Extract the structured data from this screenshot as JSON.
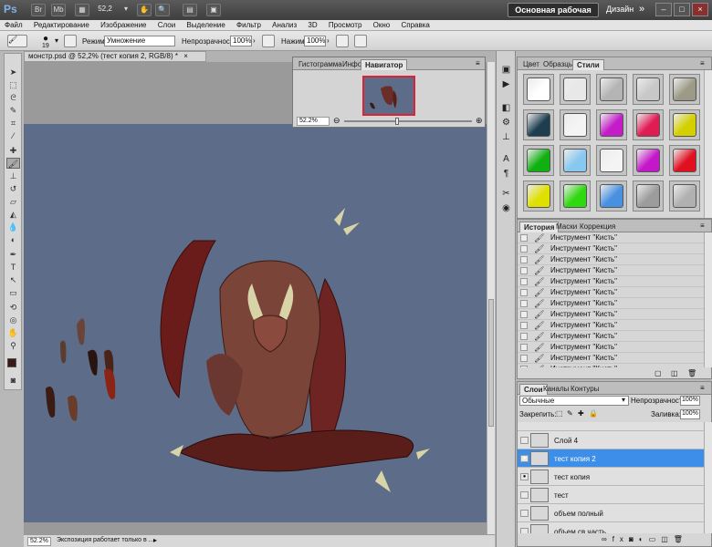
{
  "appbar": {
    "logo": "Ps",
    "btn_br": "Br",
    "btn_mb": "Mb",
    "zoom": "52,2",
    "workspace": "Основная рабочая среда",
    "design": "Дизайн",
    "more": "»",
    "min": "–",
    "max": "□",
    "close": "×"
  },
  "menu": [
    "Файл",
    "Редактирование",
    "Изображение",
    "Слои",
    "Выделение",
    "Фильтр",
    "Анализ",
    "3D",
    "Просмотр",
    "Окно",
    "Справка"
  ],
  "options": {
    "brush_size": "19",
    "mode_label": "Режим:",
    "mode_value": "Умножение",
    "opacity_label": "Непрозрачность:",
    "opacity_value": "100%",
    "press_label": "Нажим:",
    "press_value": "100%"
  },
  "document": {
    "tab_title": "монстр.psd @ 52,2% (тест копия 2, RGB/8) *",
    "tab_close": "×",
    "status_zoom": "52.2%",
    "status_text": "Экспозиция работает только в ..."
  },
  "navigator": {
    "tabs": [
      "Гистограмма",
      "Инфо",
      "Навигатор"
    ],
    "zoom": "52.2%"
  },
  "styles_panel": {
    "tabs": [
      "Цвет",
      "Образцы",
      "Стили"
    ],
    "swatches": [
      "#ffffff",
      "#e8e8e8",
      "#b4b4b4",
      "#c8c8c8",
      "#9c9a86",
      "#1c3e50",
      "#f4f4f4",
      "#c41cc8",
      "#e01c54",
      "#d4d000",
      "#10b010",
      "#88c8f0",
      "#f4f4f4",
      "#c418c8",
      "#e01020",
      "#e0e000",
      "#30d810",
      "#4890e0",
      "#9c9c9c",
      "#b0b0b0"
    ]
  },
  "history_panel": {
    "tabs": [
      "История",
      "Маски",
      "Коррекция"
    ],
    "items": [
      "Инструмент \"Кисть\"",
      "Инструмент \"Кисть\"",
      "Инструмент \"Кисть\"",
      "Инструмент \"Кисть\"",
      "Инструмент \"Кисть\"",
      "Инструмент \"Кисть\"",
      "Инструмент \"Кисть\"",
      "Инструмент \"Кисть\"",
      "Инструмент \"Кисть\"",
      "Инструмент \"Кисть\"",
      "Инструмент \"Кисть\"",
      "Инструмент \"Кисть\"",
      "Инструмент \"Кисть\""
    ]
  },
  "layers_panel": {
    "tabs": [
      "Слои",
      "Каналы",
      "Контуры"
    ],
    "blend": "Обычные",
    "opacity_label": "Непрозрачность:",
    "opacity_value": "100%",
    "lock_label": "Закрепить:",
    "fill_label": "Заливка:",
    "fill_value": "100%",
    "layers": [
      "Слой 4",
      "тест копия 2",
      "тест копия",
      "тест",
      "объем полный",
      "объем св часть"
    ]
  },
  "colors": {
    "canvas": "#5d6d89",
    "selection": "#3d8ee8",
    "fg_color": "#3a1a14"
  }
}
